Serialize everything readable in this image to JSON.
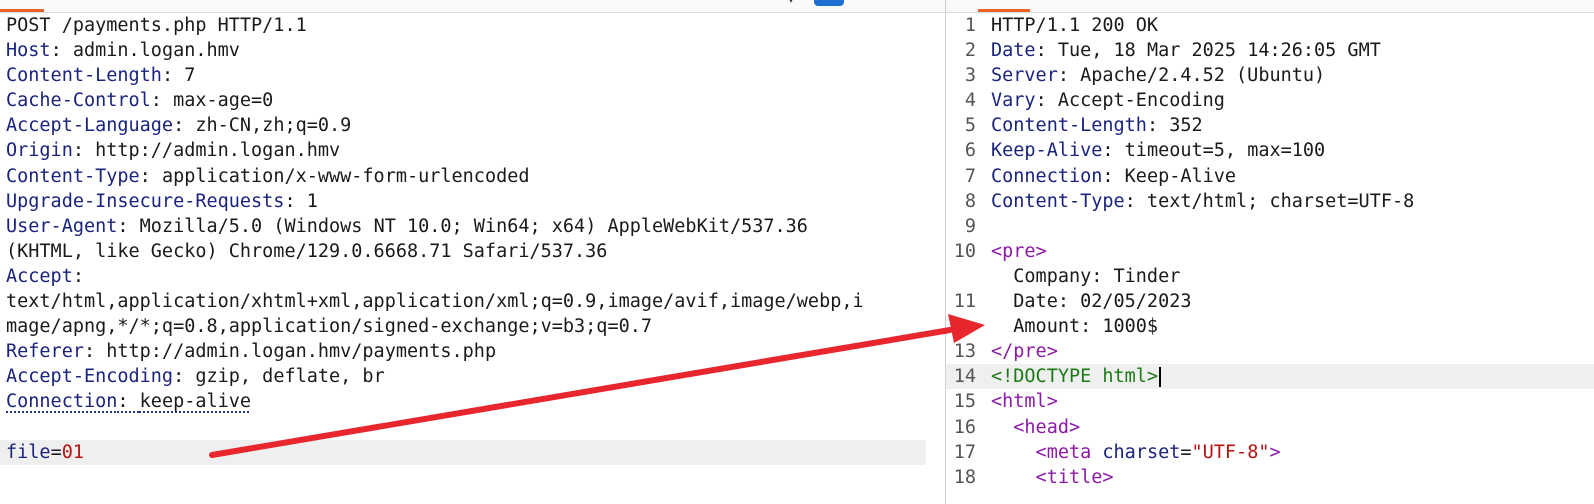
{
  "request": {
    "request_line": "POST /payments.php HTTP/1.1",
    "headers": [
      {
        "name": "Host",
        "value": "admin.logan.hmv"
      },
      {
        "name": "Content-Length",
        "value": "7"
      },
      {
        "name": "Cache-Control",
        "value": "max-age=0"
      },
      {
        "name": "Accept-Language",
        "value": "zh-CN,zh;q=0.9"
      },
      {
        "name": "Origin",
        "value": "http://admin.logan.hmv"
      },
      {
        "name": "Content-Type",
        "value": "application/x-www-form-urlencoded"
      },
      {
        "name": "Upgrade-Insecure-Requests",
        "value": "1"
      },
      {
        "name": "User-Agent",
        "value": "Mozilla/5.0 (Windows NT 10.0; Win64; x64) AppleWebKit/537.36"
      }
    ],
    "ua_continuation": "(KHTML, like Gecko) Chrome/129.0.6668.71 Safari/537.36",
    "accept_name": "Accept",
    "accept_line1": "text/html,application/xhtml+xml,application/xml;q=0.9,image/avif,image/webp,i",
    "accept_line2": "mage/apng,*/*;q=0.8,application/signed-exchange;v=b3;q=0.7",
    "headers_after": [
      {
        "name": "Referer",
        "value": "http://admin.logan.hmv/payments.php"
      },
      {
        "name": "Accept-Encoding",
        "value": "gzip, deflate, br"
      }
    ],
    "connection_name": "Connection",
    "connection_value": "keep-alive",
    "body_param_name": "file",
    "body_param_value": "01"
  },
  "response": {
    "lines": [
      {
        "num": "1",
        "name": "",
        "value": "HTTP/1.1 200 OK"
      },
      {
        "num": "2",
        "name": "Date",
        "value": "Tue, 18 Mar 2025 14:26:05 GMT"
      },
      {
        "num": "3",
        "name": "Server",
        "value": "Apache/2.4.52 (Ubuntu)"
      },
      {
        "num": "4",
        "name": "Vary",
        "value": "Accept-Encoding"
      },
      {
        "num": "5",
        "name": "Content-Length",
        "value": "352"
      },
      {
        "num": "6",
        "name": "Keep-Alive",
        "value": "timeout=5, max=100"
      },
      {
        "num": "7",
        "name": "Connection",
        "value": "Keep-Alive"
      },
      {
        "num": "8",
        "name": "Content-Type",
        "value": "text/html; charset=UTF-8"
      }
    ],
    "num_9": "9",
    "num_10": "10",
    "pre_open": "<pre>",
    "company_line": "  Company: Tinder",
    "num_11": "11",
    "date_line": "  Date: 02/05/2023",
    "amount_line": "  Amount: 1000$",
    "num_13": "13",
    "pre_close": "</pre>",
    "num_14": "14",
    "doctype": "<!DOCTYPE html>",
    "num_15": "15",
    "html_open": "<html>",
    "num_16": "16",
    "head_open": "  <head>",
    "num_17": "17",
    "meta_tag_open": "    <meta",
    "meta_attr": " charset",
    "meta_eq": "=",
    "meta_value": "\"UTF-8\"",
    "meta_close": ">",
    "num_18": "18",
    "title_open": "    <title>"
  },
  "colors": {
    "accent_tab": "#e8622c",
    "arrow": "#e8262d",
    "button": "#1f6fd1"
  },
  "icons": [
    "chevron-down-icon"
  ]
}
